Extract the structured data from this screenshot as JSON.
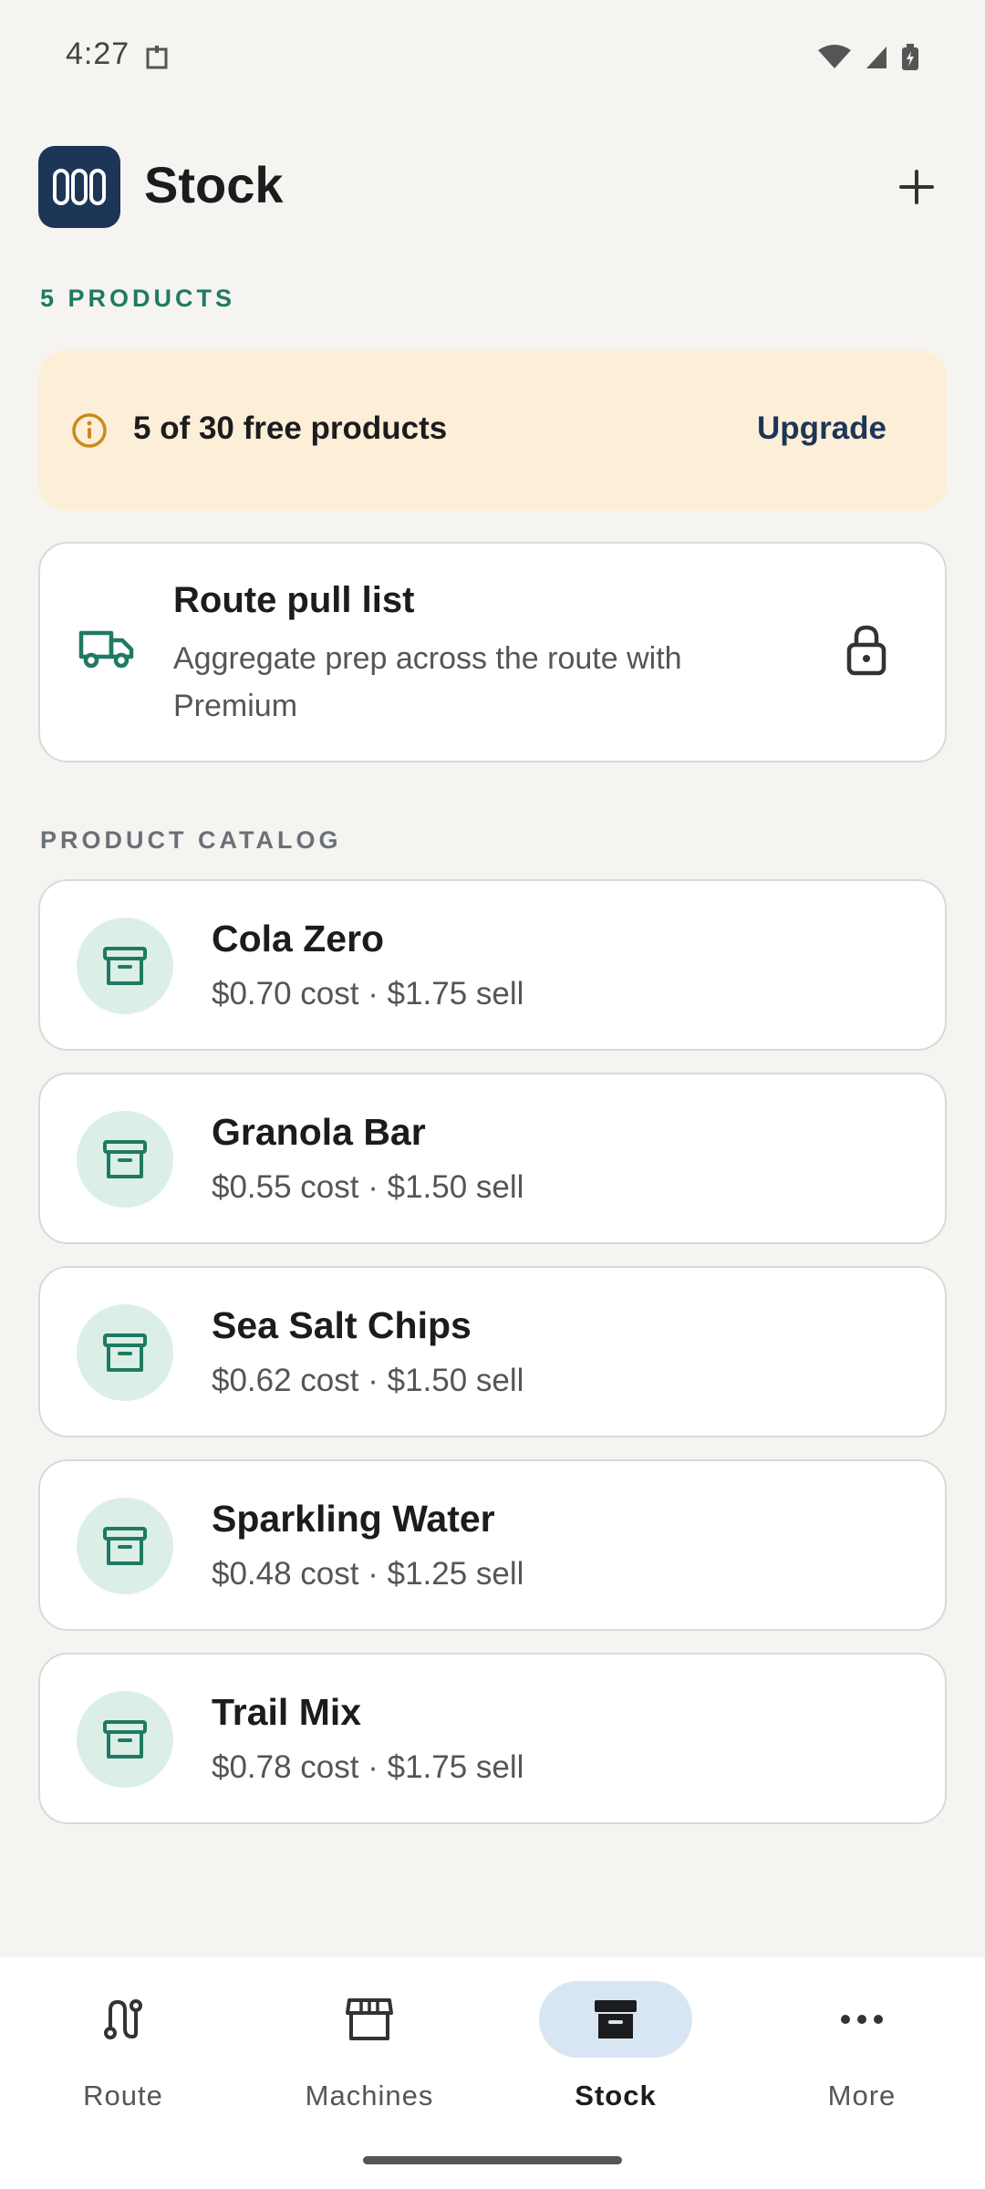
{
  "status_bar": {
    "time": "4:27"
  },
  "header": {
    "title": "Stock",
    "add_icon": "plus-icon",
    "logo_icon": "app-logo"
  },
  "summary": {
    "product_count": "5 PRODUCTS"
  },
  "banner": {
    "text": "5 of 30 free products",
    "action": "Upgrade",
    "icon": "info-icon",
    "background": "#fdeed8"
  },
  "pull_list": {
    "title": "Route pull list",
    "description": "Aggregate prep across the route with Premium",
    "icon": "truck-icon",
    "lock_icon": "lock-icon"
  },
  "catalog": {
    "label": "PRODUCT CATALOG",
    "items": [
      {
        "name": "Cola Zero",
        "price": "$0.70 cost · $1.75 sell"
      },
      {
        "name": "Granola Bar",
        "price": "$0.55 cost · $1.50 sell"
      },
      {
        "name": "Sea Salt Chips",
        "price": "$0.62 cost · $1.50 sell"
      },
      {
        "name": "Sparkling Water",
        "price": "$0.48 cost · $1.25 sell"
      },
      {
        "name": "Trail Mix",
        "price": "$0.78 cost · $1.75 sell"
      }
    ]
  },
  "bottom_nav": {
    "items": [
      {
        "label": "Route",
        "icon": "route-icon"
      },
      {
        "label": "Machines",
        "icon": "storefront-icon"
      },
      {
        "label": "Stock",
        "icon": "archive-box-icon",
        "active": true
      },
      {
        "label": "More",
        "icon": "more-dots-icon"
      }
    ]
  },
  "colors": {
    "accent": "#1f7a63",
    "brand": "#1d3557",
    "background": "#f5f4f0"
  }
}
